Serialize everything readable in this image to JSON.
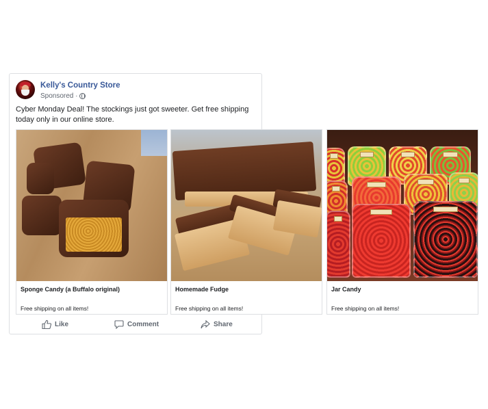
{
  "post": {
    "page_name": "Kelly's Country Store",
    "sponsored": "Sponsored ·",
    "caption": "Cyber Monday Deal! The stockings just got sweeter. Get free shipping today only in our online store."
  },
  "carousel": [
    {
      "title": "Sponge Candy (a Buffalo original)",
      "subtitle": "Free shipping on all items!"
    },
    {
      "title": "Homemade Fudge",
      "subtitle": "Free shipping on all items!"
    },
    {
      "title": "Jar Candy",
      "subtitle": "Free shipping on all items!"
    }
  ],
  "actions": {
    "like": "Like",
    "comment": "Comment",
    "share": "Share"
  },
  "colors": {
    "link": "#385898",
    "muted": "#606770",
    "border": "#dddfe2"
  },
  "icons": [
    "globe-icon",
    "like-icon",
    "comment-icon",
    "share-icon"
  ]
}
